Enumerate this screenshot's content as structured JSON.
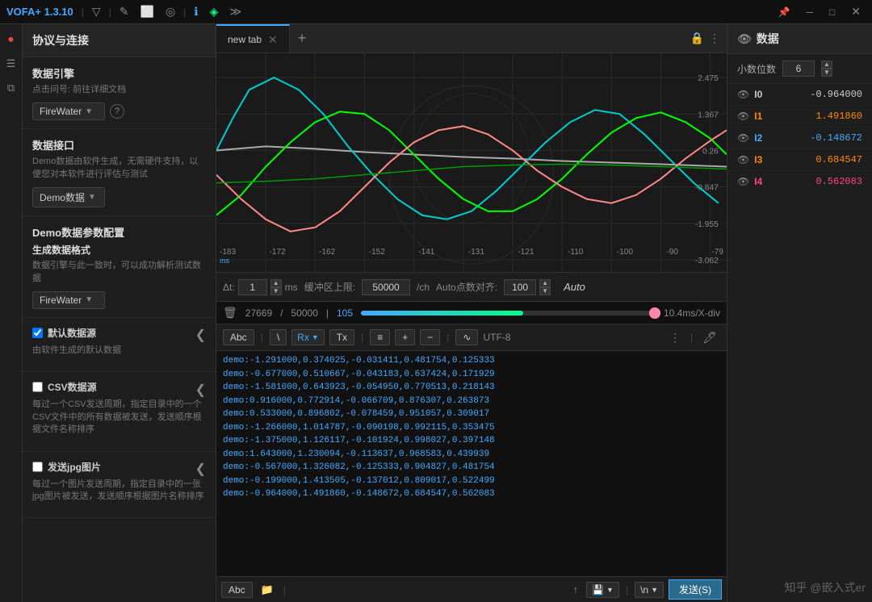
{
  "titlebar": {
    "title": "VOFA+ 1.3.10",
    "icons": [
      "▽",
      "✎",
      "⬜",
      "◎",
      "ℹ",
      "◈",
      "≫"
    ]
  },
  "left_panel": {
    "header": "协议与连接",
    "data_engine": {
      "title": "数据引擎",
      "desc_link": "点击问号: 前往详细文档",
      "dropdown_value": "FireWater",
      "help": "?"
    },
    "data_interface": {
      "title": "数据接口",
      "desc": "Demo数据由软件生成，无需硬件支持，以便您对本软件进行评估与测试",
      "dropdown_value": "Demo数据"
    },
    "demo_config": {
      "title": "Demo数据参数配置",
      "format_title": "生成数据格式",
      "format_desc": "数据引擎与此一致时，可以成功解析测试数据",
      "dropdown_value": "FireWater"
    },
    "default_source": {
      "label": "默认数据源",
      "desc": "由软件生成的默认数据"
    },
    "csv_source": {
      "label": "CSV数据源",
      "desc": "每过一个CSV发送周期，指定目录中的一个CSV文件中的所有数据被发送，发送顺序根据文件名称排序"
    },
    "jpg_source": {
      "label": "发送jpg图片",
      "desc": "每过一个图片发送周期，指定目录中的一张jpg图片被发送，发送顺序根据图片名称排序"
    }
  },
  "tab": {
    "label": "new tab"
  },
  "chart": {
    "y_labels": [
      "2.475",
      "1.367",
      "0.26",
      "-0.847",
      "-1.955",
      "-3.062"
    ],
    "x_labels": [
      "-183",
      "-172",
      "-162",
      "-152",
      "-141",
      "-131",
      "-121",
      "-110",
      "-100",
      "-90",
      "-79"
    ],
    "ms_label": "ms"
  },
  "controls": {
    "delta_t_label": "Δt:",
    "delta_t_value": "1",
    "ms_label": "ms",
    "buffer_label": "缓冲区上限:",
    "buffer_value": "50000",
    "per_ch": "/ch",
    "auto_label": "Auto点数对齐:",
    "auto_value": "100",
    "auto_text": "Auto"
  },
  "progress": {
    "current": "27669",
    "total": "50000",
    "active": "105",
    "rate": "10.4ms/X-div"
  },
  "terminal": {
    "btn_abc": "Abc",
    "btn_line": "|",
    "btn_select": "\\",
    "btn_rx": "Rx",
    "btn_tx": "Tx",
    "btn_align": "≡",
    "btn_plus": "+",
    "btn_minus": "−",
    "btn_wave": "∿",
    "encoding": "UTF-8",
    "lines": [
      "demo:-1.291000,0.374025,-0.031411,0.481754,0.125333",
      "demo:-0.677000,0.510667,-0.043183,0.637424,0.171929",
      "demo:-1.581000,0.643923,-0.054950,0.770513,0.218143",
      "demo:0.916000,0.772914,-0.066709,0.876307,0.263873",
      "demo:0.533000,0.896802,-0.078459,0.951057,0.309017",
      "demo:-1.266000,1.014787,-0.090198,0.992115,0.353475",
      "demo:-1.375000,1.126117,-0.101924,0.998027,0.397148",
      "demo:1.643000,1.230094,-0.113637,0.968583,0.439939",
      "demo:-0.567000,1.326082,-0.125333,0.904827,0.481754",
      "demo:-0.199000,1.413505,-0.137012,0.809017,0.522499",
      "demo:-0.964000,1.491860,-0.148672,0.684547,0.562083"
    ]
  },
  "right_panel": {
    "header": "数据",
    "decimal_label": "小数位数",
    "decimal_value": "6",
    "channels": [
      {
        "name": "I0",
        "value": "-0.964000",
        "color": "c-i0"
      },
      {
        "name": "I1",
        "value": "1.491860",
        "color": "c-i1"
      },
      {
        "name": "I2",
        "value": "-0.148672",
        "color": "c-i2"
      },
      {
        "name": "I3",
        "value": "0.684547",
        "color": "c-i3"
      },
      {
        "name": "I4",
        "value": "0.562083",
        "color": "c-i4"
      }
    ]
  },
  "send_bottom": {
    "abc_btn": "Abc",
    "send_label": "发送(S)",
    "newline_label": "\\n"
  },
  "watermark": "知乎 @嵌入式er"
}
